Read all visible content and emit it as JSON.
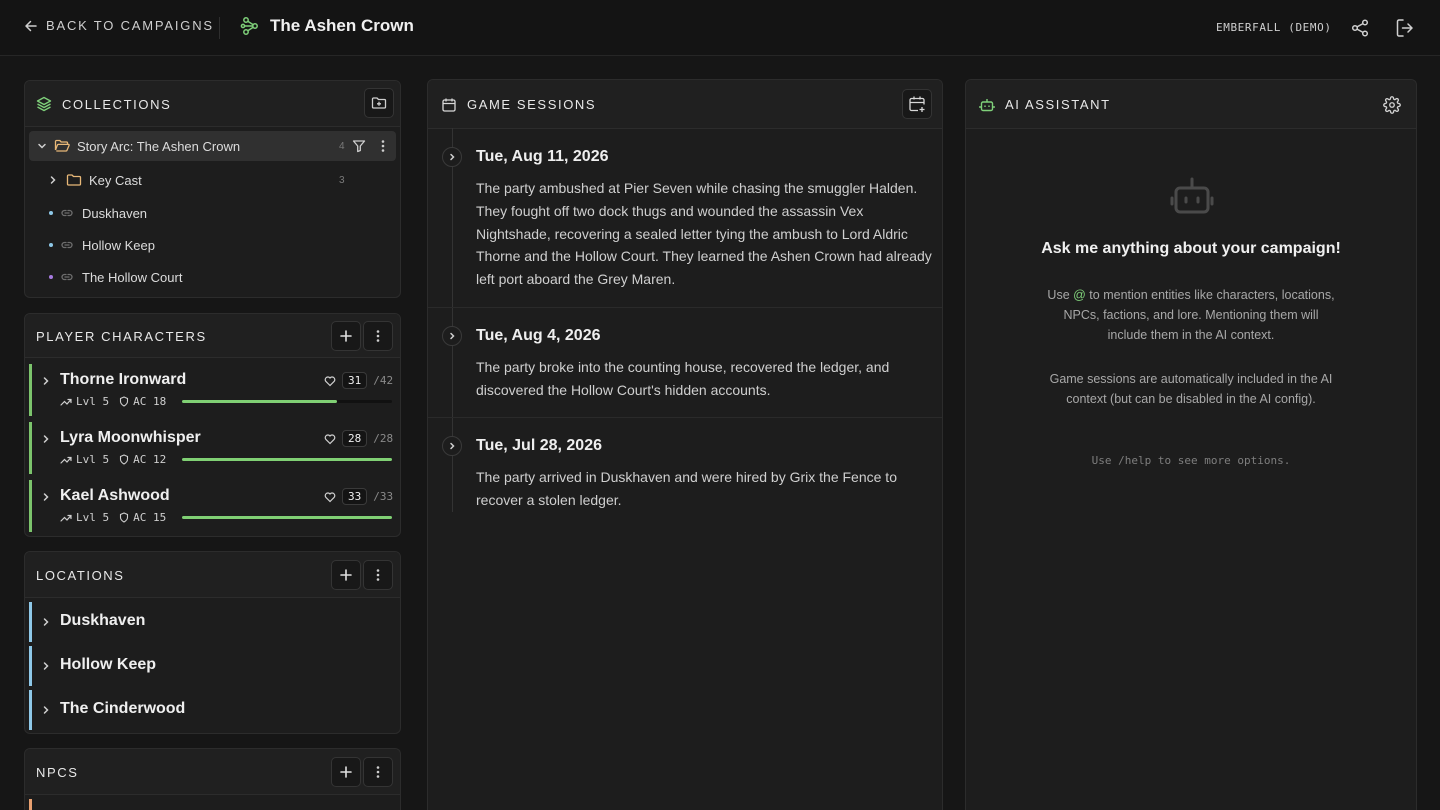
{
  "topbar": {
    "back_label": "BACK TO CAMPAIGNS",
    "campaign_title": "The Ashen Crown",
    "user_label": "EMBERFALL (DEMO)"
  },
  "collections": {
    "title": "COLLECTIONS",
    "folder": {
      "label": "Story Arc: The Ashen Crown",
      "count": "4"
    },
    "subfolder": {
      "label": "Key Cast",
      "count": "3"
    },
    "links": [
      {
        "label": "Duskhaven",
        "color": "#8ec8e8"
      },
      {
        "label": "Hollow Keep",
        "color": "#8ec8e8"
      },
      {
        "label": "The Hollow Court",
        "color": "#a77be0"
      }
    ]
  },
  "player_characters": {
    "title": "PLAYER CHARACTERS",
    "items": [
      {
        "name": "Thorne Ironward",
        "level": "Lvl 5",
        "ac": "AC 18",
        "hp": "31",
        "hp_max": "/42",
        "hp_fraction": 0.74
      },
      {
        "name": "Lyra Moonwhisper",
        "level": "Lvl 5",
        "ac": "AC 12",
        "hp": "28",
        "hp_max": "/28",
        "hp_fraction": 1.0
      },
      {
        "name": "Kael Ashwood",
        "level": "Lvl 5",
        "ac": "AC 15",
        "hp": "33",
        "hp_max": "/33",
        "hp_fraction": 1.0
      }
    ]
  },
  "locations": {
    "title": "LOCATIONS",
    "items": [
      {
        "name": "Duskhaven"
      },
      {
        "name": "Hollow Keep"
      },
      {
        "name": "The Cinderwood"
      }
    ]
  },
  "npcs": {
    "title": "NPCS"
  },
  "sessions": {
    "title": "GAME SESSIONS",
    "items": [
      {
        "date": "Tue, Aug 11, 2026",
        "text": "The party ambushed at Pier Seven while chasing the smuggler Halden. They fought off two dock thugs and wounded the assassin Vex Nightshade, recovering a sealed letter tying the ambush to Lord Aldric Thorne and the Hollow Court. They learned the Ashen Crown had already left port aboard the Grey Maren."
      },
      {
        "date": "Tue, Aug 4, 2026",
        "text": "The party broke into the counting house, recovered the ledger, and discovered the Hollow Court's hidden accounts."
      },
      {
        "date": "Tue, Jul 28, 2026",
        "text": "The party arrived in Duskhaven and were hired by Grix the Fence to recover a stolen ledger."
      }
    ]
  },
  "ai": {
    "title": "AI ASSISTANT",
    "question": "Ask me anything about your campaign!",
    "mention_before": "Use ",
    "mention_symbol": "@",
    "mention_after": " to mention entities like characters, locations, NPCs, factions, and lore. Mentioning them will include them in the AI context.",
    "sessions_note": "Game sessions are automatically included in the AI context (but can be disabled in the AI config).",
    "help_hint": "Use /help to see more options."
  },
  "colors": {
    "accent": "#7fd07a",
    "location": "#8ec8e8",
    "npc": "#e8a070",
    "faction": "#a77be0",
    "folder": "#e8b878"
  }
}
